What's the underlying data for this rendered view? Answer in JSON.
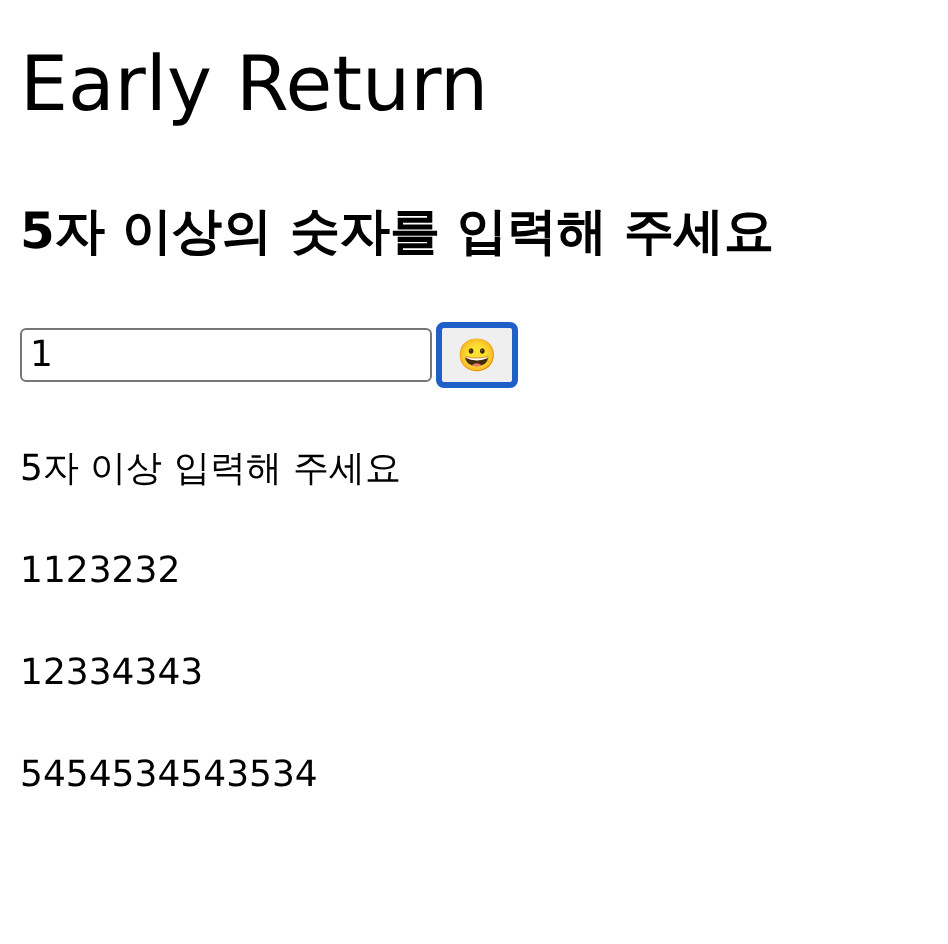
{
  "title": "Early Return",
  "subtitle": "5자 이상의 숫자를 입력해 주세요",
  "input": {
    "value": "1"
  },
  "button": {
    "label": "😀",
    "focused": true
  },
  "messages": [
    "5자 이상 입력해 주세요",
    "1123232",
    "12334343",
    "5454534543534"
  ]
}
